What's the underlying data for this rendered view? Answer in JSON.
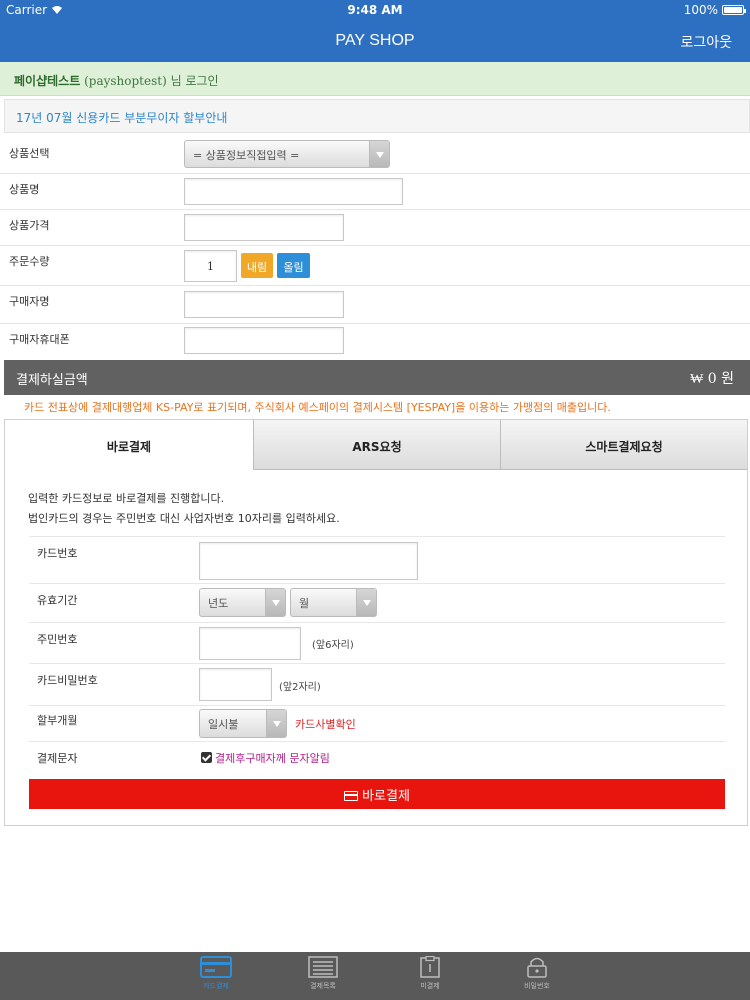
{
  "status_bar": {
    "carrier": "Carrier",
    "time": "9:48 AM",
    "battery": "100%"
  },
  "header": {
    "title": "PAY SHOP",
    "logout": "로그아웃"
  },
  "login": {
    "name": "페이샵테스트",
    "user_id": "(payshoptest)",
    "suffix": "님 로그인"
  },
  "notice": {
    "text": "17년 07월 신용카드 부분무이자 할부안내"
  },
  "form": {
    "product_select_label": "상품선택",
    "product_select_value": "= 상품정보직접입력 =",
    "product_name_label": "상품명",
    "product_price_label": "상품가격",
    "quantity_label": "주문수량",
    "quantity_value": "1",
    "qty_down": "내림",
    "qty_up": "올림",
    "buyer_name_label": "구매자명",
    "buyer_phone_label": "구매자휴대폰"
  },
  "amount": {
    "label": "결제하실금액",
    "value": "₩ 0 원"
  },
  "info_line": "카드 전표상에 결제대행업체 KS-PAY로 표기되며, 주식회사 예스페이의 결제시스템 [YESPAY]을 이용하는 가맹점의 매출입니다.",
  "tabs": [
    {
      "label": "바로결제"
    },
    {
      "label": "ARS요청"
    },
    {
      "label": "스마트결제요청"
    }
  ],
  "payment": {
    "desc1": "입력한 카드정보로 바로결제를 진행합니다.",
    "desc2": "법인카드의 경우는 주민번호 대신 사업자번호 10자리를 입력하세요.",
    "card_number_label": "카드번호",
    "expiry_label": "유효기간",
    "expiry_year": "년도",
    "expiry_month": "월",
    "ssn_label": "주민번호",
    "ssn_hint": "(앞6자리)",
    "card_pw_label": "카드비밀번호",
    "card_pw_hint": "(앞2자리)",
    "installment_label": "할부개월",
    "installment_value": "일시불",
    "card_check": "카드사별확인",
    "sms_label": "결제문자",
    "sms_check": "결제후구매자께 문자알림",
    "pay_button": "바로결제"
  },
  "tabbar": [
    {
      "label": "카드결제"
    },
    {
      "label": "결제목록"
    },
    {
      "label": "미결제"
    },
    {
      "label": "비밀번호"
    }
  ],
  "colors": {
    "primary": "#2d6fc1",
    "accent_red": "#e8150f",
    "notice_orange": "#e8731d",
    "link_blue": "#2f86c8"
  }
}
